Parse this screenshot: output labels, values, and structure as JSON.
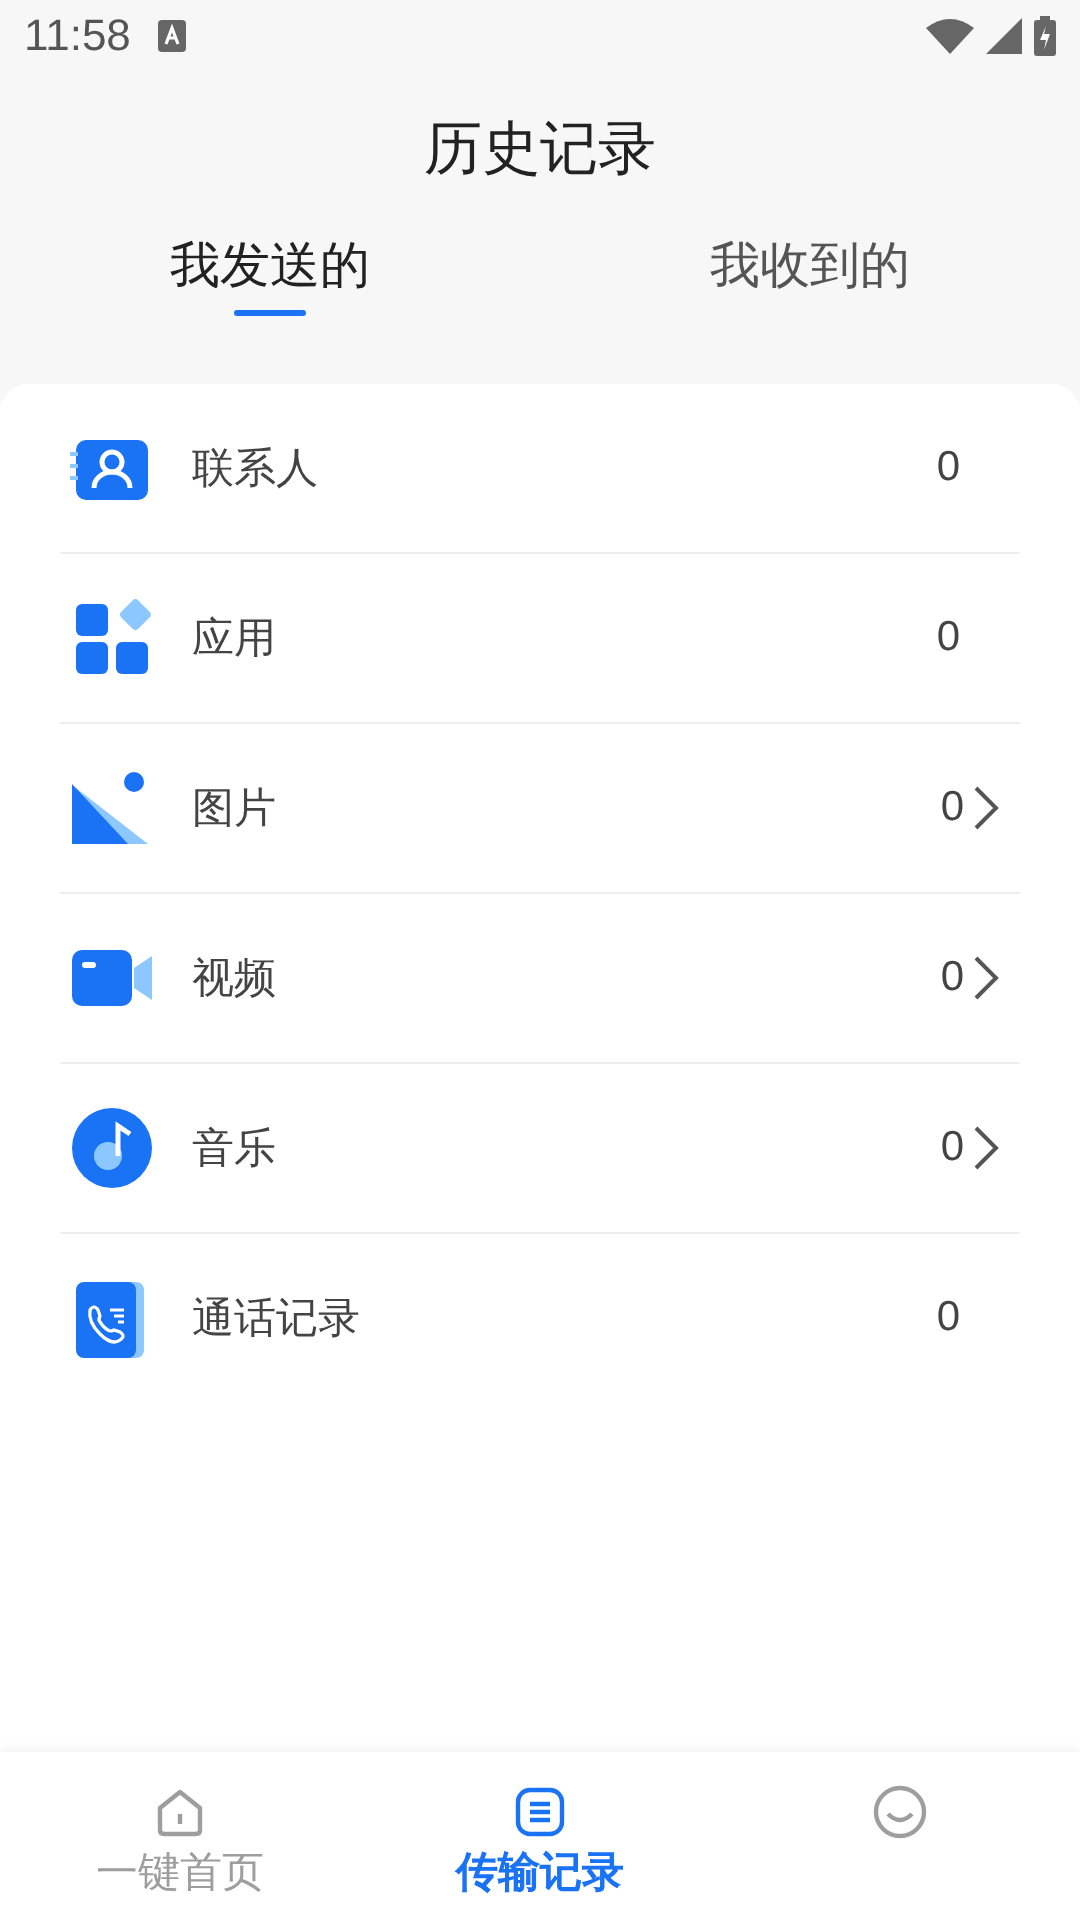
{
  "status_bar": {
    "time": "11:58"
  },
  "title": "历史记录",
  "tabs": [
    {
      "label": "我发送的",
      "selected": true
    },
    {
      "label": "我收到的",
      "selected": false
    }
  ],
  "rows": [
    {
      "kind": "contacts",
      "label": "联系人",
      "count": "0",
      "chevron": false
    },
    {
      "kind": "apps",
      "label": "应用",
      "count": "0",
      "chevron": false
    },
    {
      "kind": "images",
      "label": "图片",
      "count": "0",
      "chevron": true
    },
    {
      "kind": "video",
      "label": "视频",
      "count": "0",
      "chevron": true
    },
    {
      "kind": "music",
      "label": "音乐",
      "count": "0",
      "chevron": true
    },
    {
      "kind": "calls",
      "label": "通话记录",
      "count": "0",
      "chevron": false
    }
  ],
  "bottom_nav": [
    {
      "kind": "home",
      "label": "一键首页",
      "selected": false
    },
    {
      "kind": "records",
      "label": "传输记录",
      "selected": true
    },
    {
      "kind": "profile",
      "selected": false
    }
  ]
}
